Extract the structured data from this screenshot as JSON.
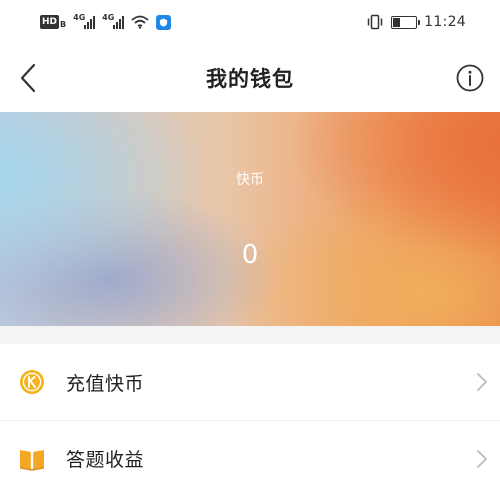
{
  "status_bar": {
    "hd_label": "HD",
    "hd_sub": "B",
    "network_1": "4G",
    "network_2": "4G",
    "time": "11:24",
    "battery_level": 0.35
  },
  "header": {
    "title": "我的钱包"
  },
  "wallet": {
    "currency_label": "快币",
    "balance": "0"
  },
  "menu": {
    "items": [
      {
        "label": "充值快币",
        "icon": "coin-icon"
      },
      {
        "label": "答题收益",
        "icon": "book-icon"
      }
    ]
  },
  "colors": {
    "coin": "#f5b21c",
    "book": "#f5a623",
    "chevron": "#bbbbbb",
    "title_text": "#222222"
  }
}
